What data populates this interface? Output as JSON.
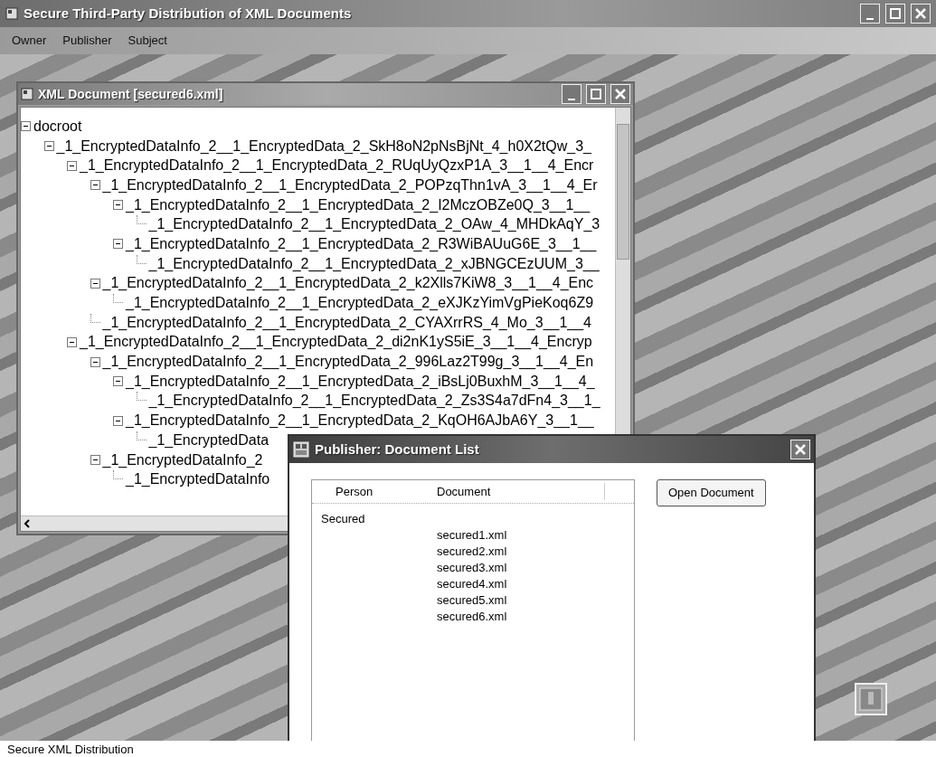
{
  "window": {
    "title": "Secure Third-Party Distribution of XML Documents"
  },
  "menu": [
    "Owner",
    "Publisher",
    "Subject"
  ],
  "document_window": {
    "title": "XML Document [secured6.xml]",
    "tree": [
      {
        "label": "docroot",
        "expanded": true,
        "children": [
          {
            "label": "_1_EncryptedDataInfo_2__1_EncryptedData_2_SkH8oN2pNsBjNt_4_h0X2tQw_3_",
            "expanded": true,
            "children": [
              {
                "label": "_1_EncryptedDataInfo_2__1_EncryptedData_2_RUqUyQzxP1A_3__1__4_Encr",
                "expanded": true,
                "children": [
                  {
                    "label": "_1_EncryptedDataInfo_2__1_EncryptedData_2_POPzqThn1vA_3__1__4_Er",
                    "expanded": true,
                    "children": [
                      {
                        "label": "_1_EncryptedDataInfo_2__1_EncryptedData_2_I2MczOBZe0Q_3__1__",
                        "expanded": true,
                        "children": [
                          {
                            "label": "_1_EncryptedDataInfo_2__1_EncryptedData_2_OAw_4_MHDkAqY_3"
                          }
                        ]
                      },
                      {
                        "label": "_1_EncryptedDataInfo_2__1_EncryptedData_2_R3WiBAUuG6E_3__1__",
                        "expanded": true,
                        "children": [
                          {
                            "label": "_1_EncryptedDataInfo_2__1_EncryptedData_2_xJBNGCEzUUM_3__"
                          }
                        ]
                      }
                    ]
                  },
                  {
                    "label": "_1_EncryptedDataInfo_2__1_EncryptedData_2_k2Xlls7KiW8_3__1__4_Enc",
                    "expanded": true,
                    "children": [
                      {
                        "label": "_1_EncryptedDataInfo_2__1_EncryptedData_2_eXJKzYimVgPieKoq6Z9"
                      }
                    ]
                  },
                  {
                    "label": "_1_EncryptedDataInfo_2__1_EncryptedData_2_CYAXrrRS_4_Mo_3__1__4"
                  }
                ]
              },
              {
                "label": "_1_EncryptedDataInfo_2__1_EncryptedData_2_di2nK1yS5iE_3__1__4_Encryp",
                "expanded": true,
                "children": [
                  {
                    "label": "_1_EncryptedDataInfo_2__1_EncryptedData_2_996Laz2T99g_3__1__4_En",
                    "expanded": true,
                    "children": [
                      {
                        "label": "_1_EncryptedDataInfo_2__1_EncryptedData_2_iBsLj0BuxhM_3__1__4_",
                        "expanded": true,
                        "children": [
                          {
                            "label": "_1_EncryptedDataInfo_2__1_EncryptedData_2_Zs3S4a7dFn4_3__1_"
                          }
                        ]
                      },
                      {
                        "label": "_1_EncryptedDataInfo_2__1_EncryptedData_2_KqOH6AJbA6Y_3__1__",
                        "expanded": true,
                        "children": [
                          {
                            "label": "_1_EncryptedData"
                          }
                        ]
                      }
                    ]
                  },
                  {
                    "label": "_1_EncryptedDataInfo_2",
                    "expanded": true,
                    "children": [
                      {
                        "label": "_1_EncryptedDataInfo"
                      }
                    ]
                  }
                ]
              }
            ]
          }
        ]
      }
    ]
  },
  "dialog": {
    "title": "Publisher: Document List",
    "columns": [
      "Person",
      "Document"
    ],
    "groups": [
      {
        "person": "Secured",
        "documents": [
          "secured1.xml",
          "secured2.xml",
          "secured3.xml",
          "secured4.xml",
          "secured5.xml",
          "secured6.xml"
        ]
      }
    ],
    "button": "Open Document"
  },
  "status_bar": "Secure XML Distribution"
}
